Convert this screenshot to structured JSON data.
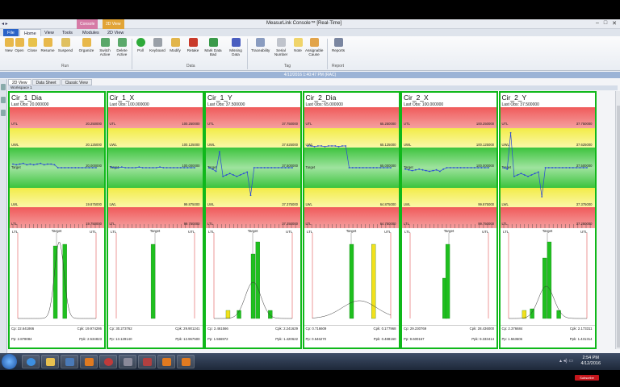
{
  "titlebar": {
    "quick_access": "◂ ▸",
    "title": "MeasurLink Console™ [Real-Time]",
    "context_tab_1": "Console",
    "context_tab_2": "2D View"
  },
  "ribbon_tabs": [
    "File",
    "Home",
    "View",
    "Tools",
    "Modules",
    "2D View"
  ],
  "ribbon": {
    "buttons": [
      "New",
      "Open",
      "Close",
      "Resume",
      "Suspend",
      "Organize",
      "Switch Active",
      "Delete Active",
      "Poll",
      "Keyboard",
      "Modify",
      "Retake",
      "Mark Data Bad",
      "Missing Data",
      "Traceability",
      "Serial Number",
      "Note",
      "Assignable Cause",
      "Reports"
    ],
    "groups": [
      "Run",
      "Data",
      "Tag",
      "Report"
    ]
  },
  "status_timestamp": "4/12/2016 1:40:47 PM (RAC)",
  "view_tabs": [
    "2D View",
    "Data Sheet",
    "Classic View"
  ],
  "workspace": "Workspace 1",
  "labels": {
    "target": "Target",
    "utl": "UTL",
    "uwl": "UWL",
    "lwl": "LWL",
    "ltl": "LTL"
  },
  "panels": [
    {
      "title": "Cir_1_Dia",
      "last_obs": "Last Obs: 20.000000",
      "utl": "20.250000",
      "uwl": "20.125000",
      "target_v": "20.000000",
      "lwl": "19.875000",
      "ltl": "19.750000",
      "cp": "Cp: 22.641866",
      "cpk": "Cpk: 19.974286",
      "pp": "Pp: 2.878084",
      "ppk": "Ppk: 2.534823",
      "series": [
        0.45,
        0.46,
        0.45,
        0.44,
        0.46,
        0.45,
        0.46,
        0.45,
        0.44,
        0.46,
        0.45,
        0.45,
        0.46,
        0.5,
        0.5,
        0.5,
        0.5,
        0.5,
        0.5,
        0.5,
        0.5,
        0.5,
        0.5,
        0.5,
        0.5
      ],
      "hist_bars": [
        {
          "pos": 0.48,
          "h": 0.9,
          "c": "#1fbf1f"
        },
        {
          "pos": 0.6,
          "h": 0.92,
          "c": "#1fbf1f"
        }
      ],
      "curve": {
        "mu": 0.53,
        "sigma": 0.06,
        "h": 0.95
      }
    },
    {
      "title": "Cir_1_X",
      "last_obs": "Last Obs: 100.000000",
      "utl": "100.250000",
      "uwl": "100.125000",
      "target_v": "100.000000",
      "lwl": "99.875000",
      "ltl": "99.750000",
      "cp": "Cp: 30.273762",
      "cpk": "Cpk: 29.901241",
      "pp": "Pp: 13.129140",
      "ppk": "Ppk: 12.967500",
      "series": [
        0.49,
        0.5,
        0.5,
        0.49,
        0.5,
        0.5,
        0.5,
        0.5,
        0.49,
        0.5,
        0.5,
        0.5,
        0.5,
        0.5,
        0.49,
        0.5,
        0.5,
        0.5,
        0.5,
        0.5,
        0.5,
        0.5,
        0.5,
        0.5,
        0.5
      ],
      "hist_bars": [
        {
          "pos": 0.47,
          "h": 0.92,
          "c": "#1fbf1f"
        }
      ],
      "curve": null
    },
    {
      "title": "Cir_1_Y",
      "last_obs": "Last Obs: 37.500000",
      "utl": "37.750000",
      "uwl": "37.625000",
      "target_v": "37.500000",
      "lwl": "37.375000",
      "ltl": "37.250000",
      "cp": "Cp: 2.461566",
      "cpk": "Cpk: 2.241629",
      "pp": "Pp: 1.556972",
      "ppk": "Ppk: 1.420622",
      "series": [
        0.5,
        0.52,
        0.55,
        0.28,
        0.62,
        0.6,
        0.58,
        0.6,
        0.62,
        0.6,
        0.58,
        0.56,
        0.88,
        0.5,
        0.5,
        0.5,
        0.5,
        0.5,
        0.5,
        0.5,
        0.5,
        0.5,
        0.5,
        0.5,
        0.5
      ],
      "hist_bars": [
        {
          "pos": 0.18,
          "h": 0.1,
          "c": "#f2e01c"
        },
        {
          "pos": 0.32,
          "h": 0.1,
          "c": "#1fbf1f"
        },
        {
          "pos": 0.5,
          "h": 0.8,
          "c": "#1fbf1f"
        },
        {
          "pos": 0.56,
          "h": 0.95,
          "c": "#1fbf1f"
        },
        {
          "pos": 0.72,
          "h": 0.1,
          "c": "#1fbf1f"
        }
      ],
      "curve": {
        "mu": 0.5,
        "sigma": 0.1,
        "h": 0.45
      }
    },
    {
      "title": "Cir_2_Dia",
      "last_obs": "Last Obs: 65.000000",
      "utl": "65.250000",
      "uwl": "65.125000",
      "target_v": "65.000000",
      "lwl": "64.875000",
      "ltl": "64.750000",
      "cp": "Cp: 0.716609",
      "cpk": "Cpk: 0.177968",
      "pp": "Pp: 0.546270",
      "ppk": "Ppk: 0.488160",
      "series": [
        0.2,
        0.2,
        0.21,
        0.2,
        0.2,
        0.21,
        0.2,
        0.2,
        0.2,
        0.21,
        0.2,
        0.2,
        0.5,
        0.5,
        0.5,
        0.5,
        0.5,
        0.5,
        0.5,
        0.5,
        0.5,
        0.5,
        0.5,
        0.5,
        0.5
      ],
      "hist_bars": [
        {
          "pos": 0.5,
          "h": 0.92,
          "c": "#1fbf1f"
        },
        {
          "pos": 0.78,
          "h": 0.92,
          "c": "#f2e01c"
        }
      ],
      "curve": {
        "mu": 0.6,
        "sigma": 0.22,
        "h": 0.22
      }
    },
    {
      "title": "Cir_2_X",
      "last_obs": "Last Obs: 100.000000",
      "utl": "100.250000",
      "uwl": "100.125000",
      "target_v": "100.000000",
      "lwl": "99.875000",
      "ltl": "99.750000",
      "cp": "Cp: 29.230769",
      "cpk": "Cpk: 28.436000",
      "pp": "Pp: 9.600167",
      "ppk": "Ppk: 9.333414",
      "series": [
        0.52,
        0.53,
        0.54,
        0.53,
        0.52,
        0.53,
        0.54,
        0.55,
        0.54,
        0.53,
        0.55,
        0.52,
        0.5,
        0.5,
        0.5,
        0.5,
        0.5,
        0.5,
        0.5,
        0.5,
        0.5,
        0.5,
        0.5,
        0.5,
        0.5
      ],
      "hist_bars": [
        {
          "pos": 0.44,
          "h": 0.5,
          "c": "#1fbf1f"
        },
        {
          "pos": 0.48,
          "h": 0.92,
          "c": "#1fbf1f"
        }
      ],
      "curve": null
    },
    {
      "title": "Cir_2_Y",
      "last_obs": "Last Obs: 37.500000",
      "utl": "37.750000",
      "uwl": "37.625000",
      "target_v": "37.500000",
      "lwl": "37.375000",
      "ltl": "37.250000",
      "cp": "Cp: 2.376684",
      "cpk": "Cpk: 2.173311",
      "pp": "Pp: 1.563606",
      "ppk": "Ppk: 1.431314",
      "series": [
        0.5,
        0.52,
        0.02,
        0.62,
        0.6,
        0.58,
        0.6,
        0.62,
        0.6,
        0.58,
        0.56,
        0.9,
        0.5,
        0.5,
        0.5,
        0.5,
        0.5,
        0.5,
        0.5,
        0.5,
        0.5,
        0.5,
        0.5,
        0.5,
        0.5
      ],
      "hist_bars": [
        {
          "pos": 0.2,
          "h": 0.1,
          "c": "#f2e01c"
        },
        {
          "pos": 0.3,
          "h": 0.12,
          "c": "#1fbf1f"
        },
        {
          "pos": 0.46,
          "h": 0.75,
          "c": "#1fbf1f"
        },
        {
          "pos": 0.52,
          "h": 0.95,
          "c": "#1fbf1f"
        },
        {
          "pos": 0.64,
          "h": 0.1,
          "c": "#1fbf1f"
        }
      ],
      "curve": {
        "mu": 0.48,
        "sigma": 0.1,
        "h": 0.4
      }
    }
  ],
  "taskbar": {
    "time": "2:54 PM",
    "date": "4/12/2016",
    "tray": "▴ ◂) ▭",
    "subscribe": "Subscribe"
  },
  "colors": {
    "panel_border": "#0fb81a",
    "point": "#2746d8",
    "control_zone": "#3cc33c",
    "warning_zone": "#f2ec48",
    "limit_zone": "#f05a5a"
  }
}
